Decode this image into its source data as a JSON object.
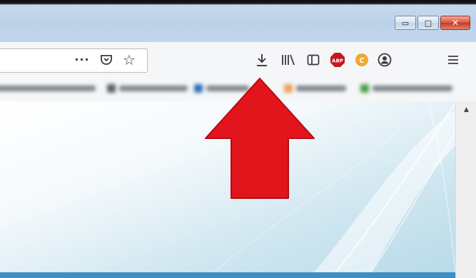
{
  "window": {
    "controls": [
      {
        "name": "minimize-button",
        "glyph": "▭"
      },
      {
        "name": "maximize-button",
        "glyph": "□"
      },
      {
        "name": "close-button",
        "glyph": "✕"
      }
    ]
  },
  "toolbar": {
    "page_actions_glyph": "···",
    "pocket_icon": "pocket-icon",
    "bookmark_star_glyph": "☆",
    "downloads_glyph": "⤓",
    "library_glyph": "Ⅲ\\",
    "sidebar_icon": "sidebar-icon",
    "abp_label": "ABP",
    "extension2_label": "C",
    "account_icon": "account-icon",
    "menu_glyph": "≡"
  },
  "colors": {
    "annotation_arrow": "#e2141c",
    "abp_badge": "#c8161d",
    "extension2_badge": "#f0a82e",
    "content_bottom_bar": "#3c8fc4"
  },
  "scrollbar": {
    "up_glyph": "▲"
  }
}
